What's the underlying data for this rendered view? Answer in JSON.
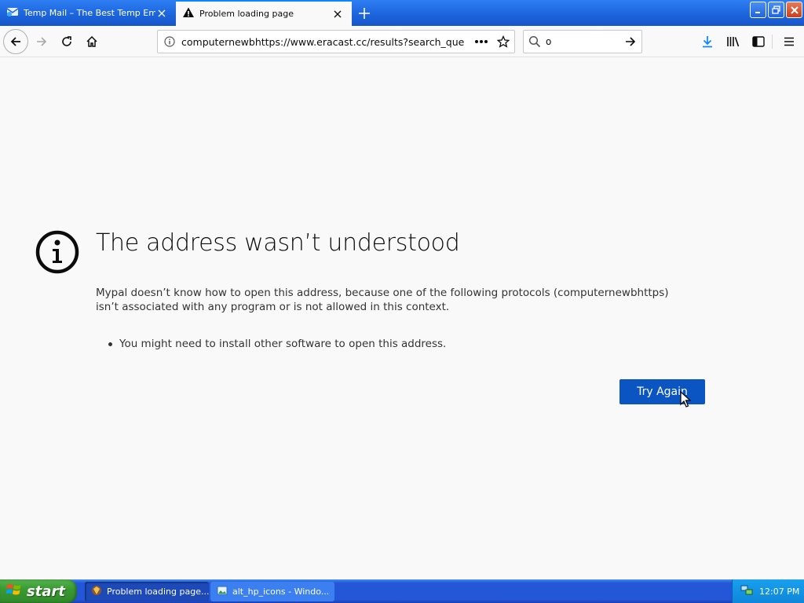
{
  "tabs": [
    {
      "title": "Temp Mail – The Best Temp Email f",
      "icon": "tempmail-favicon-icon",
      "active": false
    },
    {
      "title": "Problem loading page",
      "icon": "warning-icon",
      "active": true
    }
  ],
  "toolbar": {
    "url": "computernewbhttps://www.eracast.cc/results?search_que",
    "search_value": "o"
  },
  "error_page": {
    "title": "The address wasn’t understood",
    "description": "Mypal doesn’t know how to open this address, because one of the following protocols (computernewbhttps) isn’t associated with any program or is not allowed in this context.",
    "bullets": [
      "You might need to install other software to open this address."
    ],
    "button_label": "Try Again"
  },
  "taskbar": {
    "start_label": "start",
    "tasks": [
      {
        "label": "Problem loading page...",
        "active": true
      },
      {
        "label": "alt_hp_icons - Windo...",
        "active": false
      }
    ],
    "clock": "12:07 PM"
  },
  "colors": {
    "titlebar": "#1b63db",
    "accent": "#0a84ff",
    "button_primary": "#0a55c2",
    "start_green": "#3a9a33"
  }
}
